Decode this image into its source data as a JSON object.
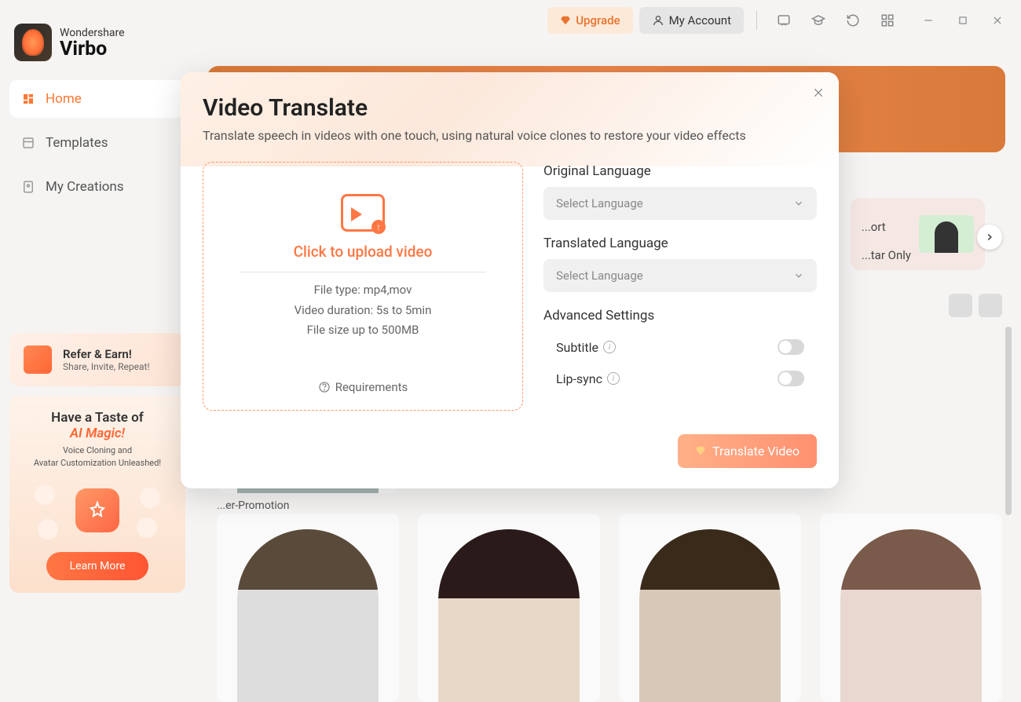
{
  "titlebar": {
    "upgrade": "Upgrade",
    "account": "My Account"
  },
  "logo": {
    "brand": "Wondershare",
    "name": "Virbo"
  },
  "sidebar": {
    "items": [
      {
        "label": "Home"
      },
      {
        "label": "Templates"
      },
      {
        "label": "My Creations"
      }
    ],
    "refer": {
      "title": "Refer & Earn!",
      "subtitle": "Share, Invite, Repeat!"
    },
    "magic": {
      "title_a": "Have a Taste of",
      "title_b": "AI Magic!",
      "subtitle": "Voice Cloning and\nAvatar Customization Unleashed!",
      "cta": "Learn More"
    }
  },
  "feature_chip": {
    "line1": "...ort",
    "line2": "...tar Only"
  },
  "avatars": {
    "row1_label": "...er-Promotion"
  },
  "modal": {
    "title": "Video Translate",
    "description": "Translate speech in videos with one touch, using natural voice clones to restore your video effects",
    "upload": {
      "cta": "Click to upload video",
      "file_type": "File type: mp4,mov",
      "duration": "Video duration: 5s to 5min",
      "size": "File size up to  500MB",
      "requirements": "Requirements"
    },
    "settings": {
      "original_label": "Original Language",
      "original_placeholder": "Select Language",
      "translated_label": "Translated Language",
      "translated_placeholder": "Select Language",
      "advanced_label": "Advanced Settings",
      "subtitle_label": "Subtitle",
      "lipsync_label": "Lip-sync"
    },
    "action": "Translate Video"
  }
}
